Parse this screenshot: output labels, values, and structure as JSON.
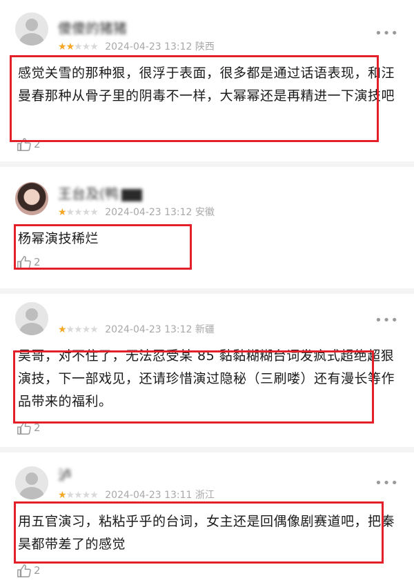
{
  "reviews": [
    {
      "username": "傻傻的猪猪",
      "stars_filled": 2,
      "date": "2024-04-23 13:12",
      "location": "陕西",
      "content": "感觉关雪的那种狠，很浮于表面，很多都是通过话语表现，和汪曼春那种从骨子里的阴毒不一样，大幂幂还是再精进一下演技吧",
      "likes": "2"
    },
    {
      "username": "王台及(鸭",
      "stars_filled": 1,
      "date": "2024-04-23 13:12",
      "location": "安徽",
      "content": "杨幂演技稀烂",
      "likes": "2"
    },
    {
      "username": "",
      "stars_filled": 1,
      "date": "2024-04-23 13:12",
      "location": "新疆",
      "content": "昊哥，对不住了，无法忍受某 85 黏黏糊糊台词发疯式超绝超狠演技，下一部戏见，还请珍惜演过隐秘（三刷喽）还有漫长等作品带来的福利。",
      "likes": "2"
    },
    {
      "username": "泸",
      "stars_filled": 1,
      "date": "2024-04-23 13:11",
      "location": "浙江",
      "content": "用五官演习，粘粘乎乎的台词，女主还是回偶像剧赛道吧，把秦昊都带差了的感觉",
      "likes": "2"
    }
  ],
  "icons": {
    "more": "more-dots-icon",
    "like": "thumbs-up-icon",
    "star": "star-icon",
    "avatar": "default-avatar-icon"
  },
  "colors": {
    "star": "#f5a623",
    "highlight": "#e3202a",
    "meta": "#a8a8a8"
  }
}
